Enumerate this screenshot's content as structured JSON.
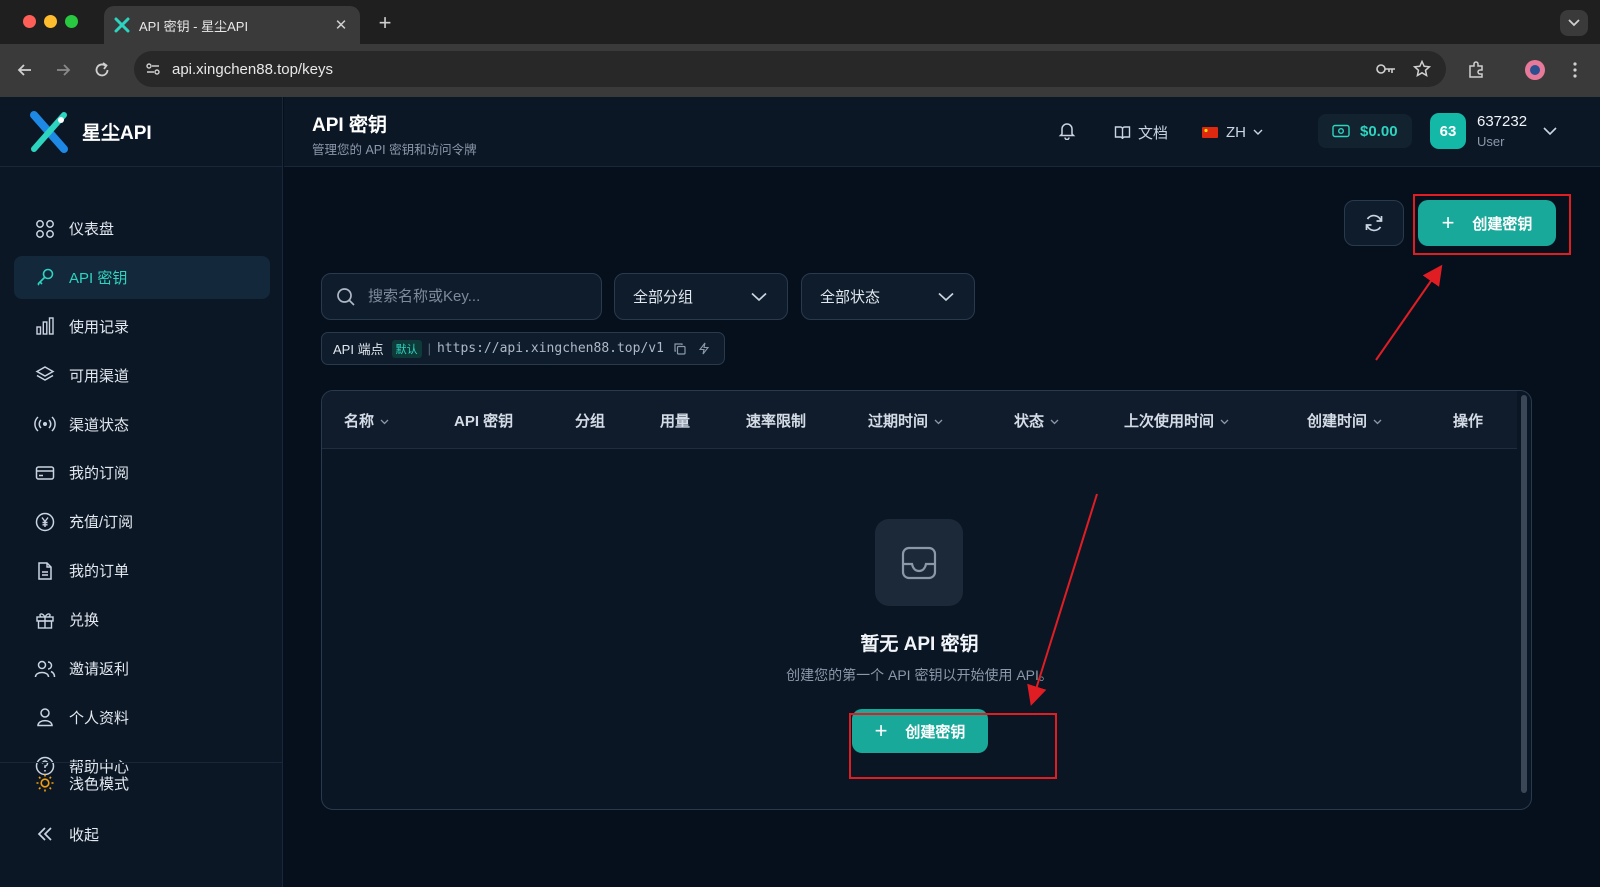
{
  "browser": {
    "tab_title": "API 密钥 - 星尘API",
    "url": "api.xingchen88.top/keys"
  },
  "brand": {
    "name": "星尘API"
  },
  "sidebar": {
    "items": [
      {
        "label": "仪表盘",
        "icon": "dashboard-icon"
      },
      {
        "label": "API 密钥",
        "icon": "key-icon",
        "active": true
      },
      {
        "label": "使用记录",
        "icon": "bar-chart-icon"
      },
      {
        "label": "可用渠道",
        "icon": "layers-icon"
      },
      {
        "label": "渠道状态",
        "icon": "signal-icon"
      },
      {
        "label": "我的订阅",
        "icon": "credit-card-icon"
      },
      {
        "label": "充值/订阅",
        "icon": "yen-coin-icon"
      },
      {
        "label": "我的订单",
        "icon": "document-icon"
      },
      {
        "label": "兑换",
        "icon": "gift-icon"
      },
      {
        "label": "邀请返利",
        "icon": "users-icon"
      },
      {
        "label": "个人资料",
        "icon": "user-icon"
      },
      {
        "label": "帮助中心",
        "icon": "help-circle-icon"
      }
    ],
    "theme_toggle": "浅色模式",
    "collapse": "收起"
  },
  "header": {
    "title": "API 密钥",
    "subtitle": "管理您的 API 密钥和访问令牌",
    "docs": "文档",
    "lang": "ZH",
    "balance": "$0.00",
    "user": {
      "avatar": "63",
      "name": "637232",
      "role": "User"
    }
  },
  "toolbar": {
    "create_label": "创建密钥"
  },
  "filters": {
    "search_placeholder": "搜索名称或Key...",
    "group": "全部分组",
    "status": "全部状态"
  },
  "endpoint": {
    "label": "API 端点",
    "badge": "默认",
    "url": "https://api.xingchen88.top/v1"
  },
  "table": {
    "columns": [
      {
        "label": "名称",
        "sortable": true
      },
      {
        "label": "API 密钥",
        "sortable": false
      },
      {
        "label": "分组",
        "sortable": false
      },
      {
        "label": "用量",
        "sortable": false
      },
      {
        "label": "速率限制",
        "sortable": false
      },
      {
        "label": "过期时间",
        "sortable": true
      },
      {
        "label": "状态",
        "sortable": true
      },
      {
        "label": "上次使用时间",
        "sortable": true
      },
      {
        "label": "创建时间",
        "sortable": true
      },
      {
        "label": "操作",
        "sortable": false
      }
    ],
    "rows": []
  },
  "empty": {
    "title": "暂无 API 密钥",
    "subtitle": "创建您的第一个 API 密钥以开始使用 API。",
    "button": "创建密钥"
  },
  "colors": {
    "accent": "#19a99b",
    "accent_text": "#2dd4bf",
    "annotation": "#e11d24",
    "background": "#06101c"
  }
}
